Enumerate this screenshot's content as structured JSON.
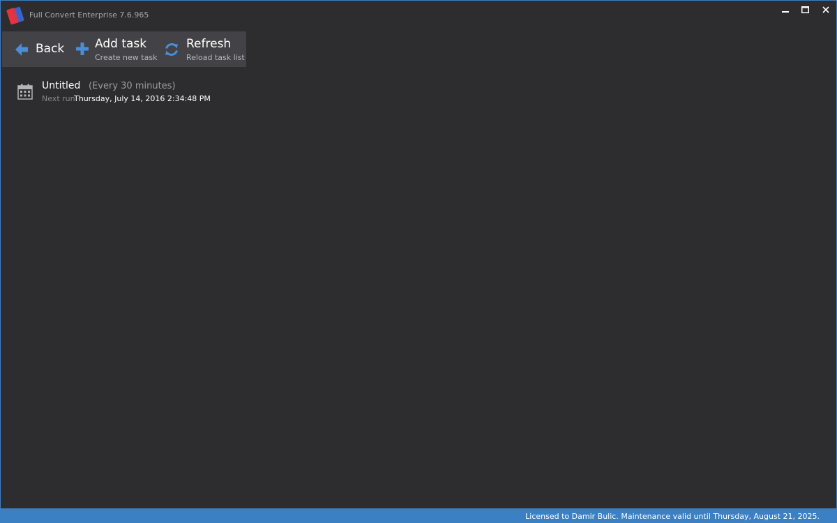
{
  "window": {
    "title": "Full Convert Enterprise 7.6.965"
  },
  "toolbar": {
    "back": {
      "label": "Back",
      "icon": "arrow-left-icon"
    },
    "add_task": {
      "label": "Add task",
      "sublabel": "Create new task",
      "icon": "plus-icon"
    },
    "refresh": {
      "label": "Refresh",
      "sublabel": "Reload task list",
      "icon": "refresh-icon"
    }
  },
  "tasks": [
    {
      "name": "Untitled",
      "schedule": "(Every 30 minutes)",
      "next_run_label": "Next run",
      "next_run_value": "Thursday, July 14, 2016 2:34:48 PM",
      "icon": "calendar-icon"
    }
  ],
  "statusbar": {
    "text": "Licensed to Damir Bulic. Maintenance valid until Thursday, August 21, 2025."
  },
  "colors": {
    "background": "#2d2d30",
    "toolbar": "#424247",
    "accent": "#3b80c3",
    "icon_blue": "#4a8fd6"
  }
}
